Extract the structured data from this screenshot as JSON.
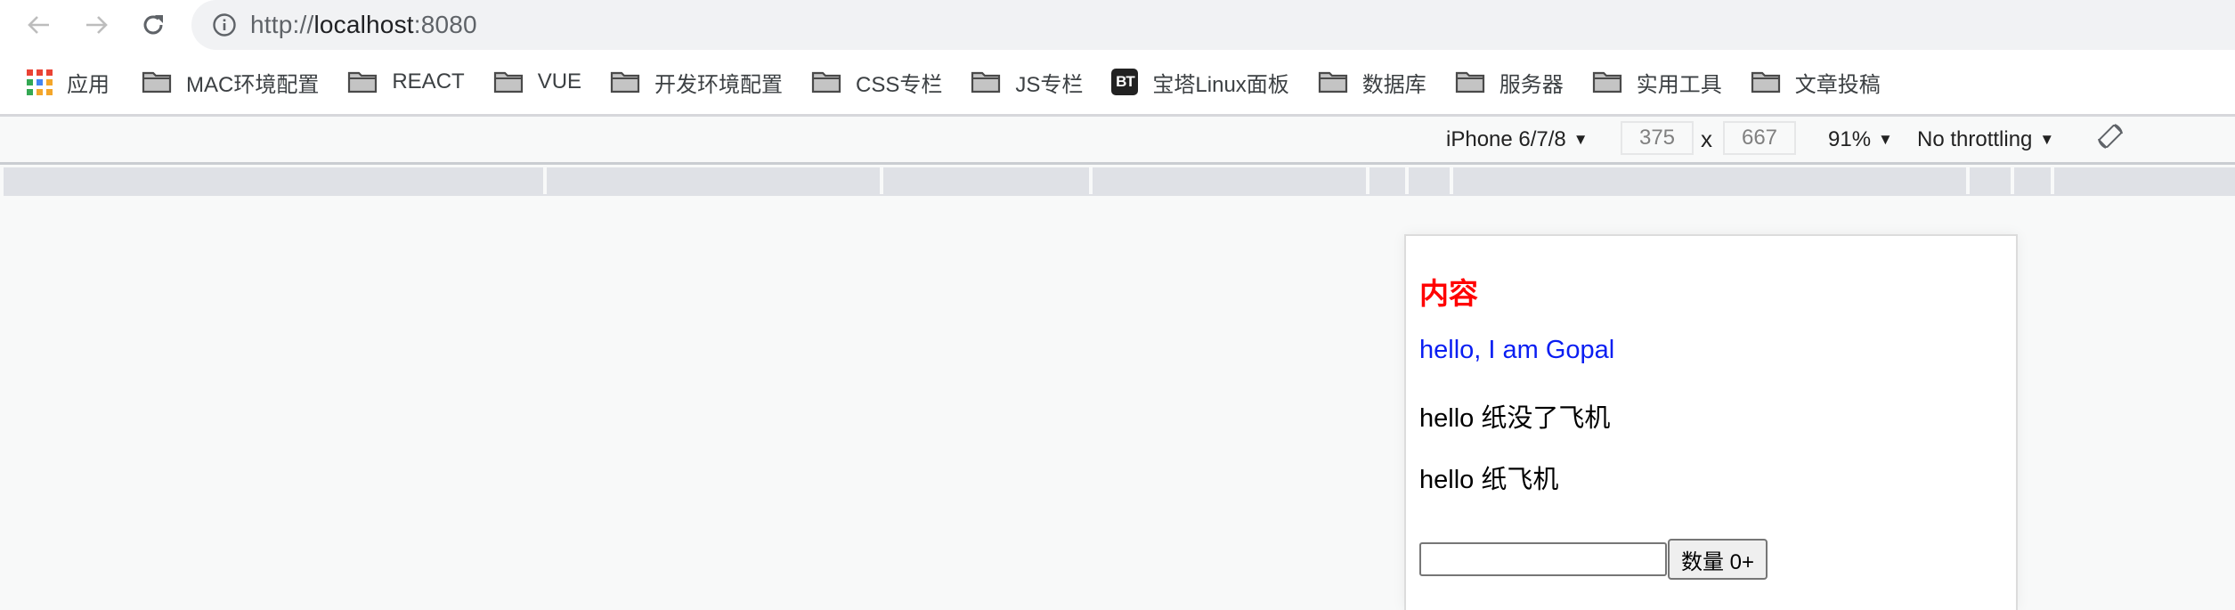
{
  "browser": {
    "url_scheme": "http://",
    "url_host": "localhost",
    "url_port": ":8080",
    "back_icon": "arrow-left-icon",
    "forward_icon": "arrow-right-icon",
    "reload_icon": "reload-icon",
    "site_info_icon": "info-circle-icon"
  },
  "bookmarks": [
    {
      "label": "应用",
      "icon": "apps-grid-icon"
    },
    {
      "label": "MAC环境配置",
      "icon": "folder-icon"
    },
    {
      "label": "REACT",
      "icon": "folder-icon"
    },
    {
      "label": "VUE",
      "icon": "folder-icon"
    },
    {
      "label": "开发环境配置",
      "icon": "folder-icon"
    },
    {
      "label": "CSS专栏",
      "icon": "folder-icon"
    },
    {
      "label": "JS专栏",
      "icon": "folder-icon"
    },
    {
      "label": "宝塔Linux面板",
      "icon": "bt-badge-icon",
      "badge_text": "BT"
    },
    {
      "label": "数据库",
      "icon": "folder-icon"
    },
    {
      "label": "服务器",
      "icon": "folder-icon"
    },
    {
      "label": "实用工具",
      "icon": "folder-icon"
    },
    {
      "label": "文章投稿",
      "icon": "folder-icon"
    }
  ],
  "device_toolbar": {
    "device": "iPhone 6/7/8",
    "width": "375",
    "height": "667",
    "times": "x",
    "zoom": "91%",
    "throttling": "No throttling",
    "caret": "▼",
    "rotate_icon": "rotate-device-icon"
  },
  "page": {
    "heading": "内容",
    "greeting": "hello, I am Gopal",
    "line_two": "hello 纸没了飞机",
    "line_three": "hello 纸飞机",
    "input_value": "",
    "count_button": "数量 0+"
  },
  "colors": {
    "heading": "#ff0000",
    "greeting": "#0a1ef2",
    "address_bar_bg": "#f1f2f4",
    "media_bar": "#dfe1e6"
  }
}
